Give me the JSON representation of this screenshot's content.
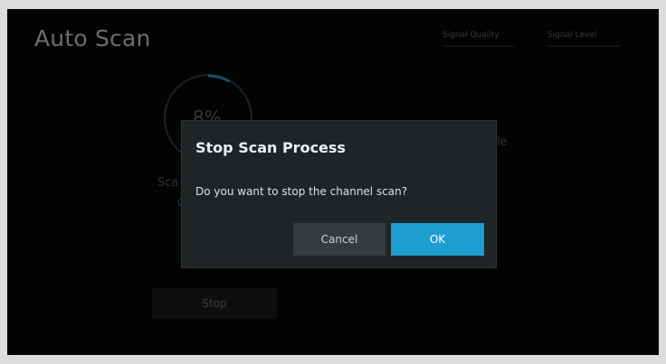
{
  "screen": {
    "title": "Auto Scan",
    "signal_quality_label": "Signal Quality",
    "signal_level_label": "Signal Level",
    "progress_text": "8%",
    "progress_fraction": 0.08,
    "bg_left_fragment": "Sca",
    "bg_left_fragment_2": "C",
    "bg_right_fragment": "le",
    "stop_label": "Stop"
  },
  "dialog": {
    "title": "Stop Scan Process",
    "message": "Do you want to stop the channel scan?",
    "cancel_label": "Cancel",
    "ok_label": "OK"
  },
  "colors": {
    "accent": "#1e9ed0",
    "dialog_bg": "#1f2426",
    "screen_bg": "#030303"
  }
}
